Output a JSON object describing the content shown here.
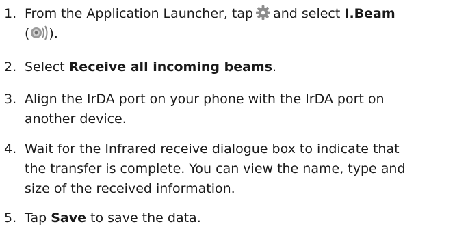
{
  "steps": [
    {
      "number": "1.",
      "text_before_icon": "From the Application Launcher, tap",
      "icon_settings": "gear-icon",
      "text_after_icon": "and select",
      "bold_name": "I.Beam",
      "open_paren": "(",
      "icon_beam": "infrared-beam-icon",
      "close_paren": ")."
    },
    {
      "number": "2.",
      "text_before": "Select",
      "bold": "Receive all incoming beams",
      "text_after": "."
    },
    {
      "number": "3.",
      "line1": "Align the IrDA port on your phone with the IrDA port on",
      "line2": "another device."
    },
    {
      "number": "4.",
      "line1": "Wait for the Infrared receive dialogue box to indicate that",
      "line2": "the transfer is complete. You can view the name, type and",
      "line3": "size of the received information."
    },
    {
      "number": "5.",
      "text_before": "Tap",
      "bold": "Save",
      "text_after": "to save the data."
    }
  ],
  "colors": {
    "text": "#1a1a1a",
    "icon_gray": "#8c8c8c"
  }
}
